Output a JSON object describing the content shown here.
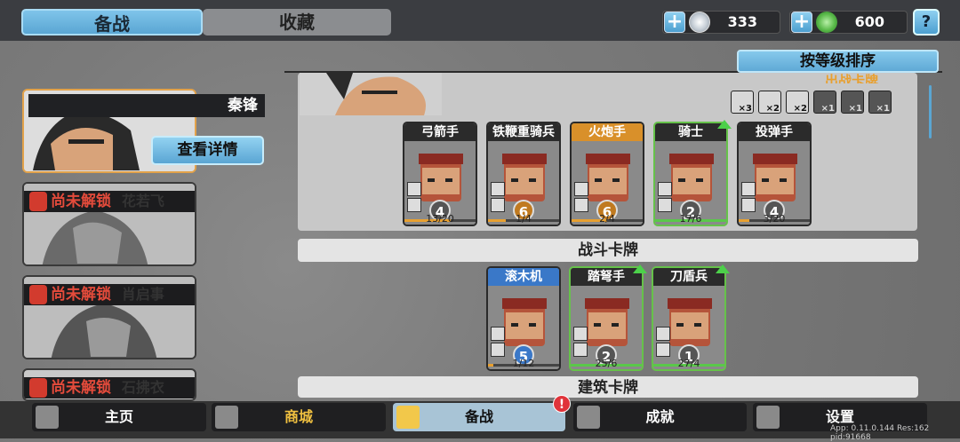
{
  "tabs": {
    "prepare": "备战",
    "collection": "收藏"
  },
  "resources": [
    {
      "icon": "silver-coin-icon",
      "value": "333",
      "color": "#c8d0d8"
    },
    {
      "icon": "green-gem-icon",
      "value": "600",
      "color": "#58b848"
    }
  ],
  "help": "?",
  "sort_button": "按等级排序",
  "heroes": {
    "selected": {
      "name": "秦锋",
      "detail_button": "查看详情"
    },
    "locked": [
      {
        "status": "尚未解锁",
        "name": "花若飞"
      },
      {
        "status": "尚未解锁",
        "name": "肖启事"
      },
      {
        "status": "尚未解锁",
        "name": "石拂衣"
      }
    ]
  },
  "deploy_panel": {
    "header": "出战卡牌",
    "counters": [
      "×3",
      "×2",
      "×2",
      "×1",
      "×1",
      "×1"
    ],
    "cards": [
      {
        "name": "弓箭手",
        "level": "4",
        "progress": "13/20",
        "fill": 0.65,
        "border": "dark",
        "title_color": "#2b2b2b",
        "level_color": "#555",
        "upgrade": false
      },
      {
        "name": "铁鞭重骑兵",
        "level": "6",
        "progress": "1/4",
        "fill": 0.25,
        "border": "dark",
        "title_color": "#2b2b2b",
        "level_color": "#c07a20",
        "upgrade": false
      },
      {
        "name": "火炮手",
        "level": "6",
        "progress": "2/4",
        "fill": 0.5,
        "border": "dark",
        "title_color": "#d9902a",
        "level_color": "#c07a20",
        "upgrade": false
      },
      {
        "name": "骑士",
        "level": "2",
        "progress": "17/6",
        "fill": 1.0,
        "border": "green",
        "title_color": "#2b2b2b",
        "level_color": "#555",
        "upgrade": true
      },
      {
        "name": "投弹手",
        "level": "4",
        "progress": "3/20",
        "fill": 0.15,
        "border": "dark",
        "title_color": "#2b2b2b",
        "level_color": "#555",
        "upgrade": false
      }
    ]
  },
  "battle_section": {
    "title": "战斗卡牌",
    "cards": [
      {
        "name": "滚木机",
        "level": "5",
        "progress": "1/12",
        "fill": 0.08,
        "border": "dark",
        "title_color": "#3a78c8",
        "level_color": "#3a78c8",
        "upgrade": false
      },
      {
        "name": "踏弩手",
        "level": "2",
        "progress": "25/6",
        "fill": 1.0,
        "border": "green",
        "title_color": "#2b2b2b",
        "level_color": "#555",
        "upgrade": true
      },
      {
        "name": "刀盾兵",
        "level": "1",
        "progress": "27/4",
        "fill": 1.0,
        "border": "green",
        "title_color": "#2b2b2b",
        "level_color": "#555",
        "upgrade": true
      }
    ]
  },
  "building_section": {
    "title": "建筑卡牌"
  },
  "nav": [
    {
      "label": "主页",
      "icon": "castle-icon",
      "active": false
    },
    {
      "label": "商城",
      "icon": "coins-icon",
      "active": false,
      "color": "#f0c040"
    },
    {
      "label": "备战",
      "icon": "cards-icon",
      "active": true,
      "badge": "!"
    },
    {
      "label": "成就",
      "icon": "achievement-icon",
      "active": false
    },
    {
      "label": "设置",
      "icon": "gear-icon",
      "active": false
    }
  ],
  "footer": "App: 0.11.0.144 Res:162 pid:91668"
}
